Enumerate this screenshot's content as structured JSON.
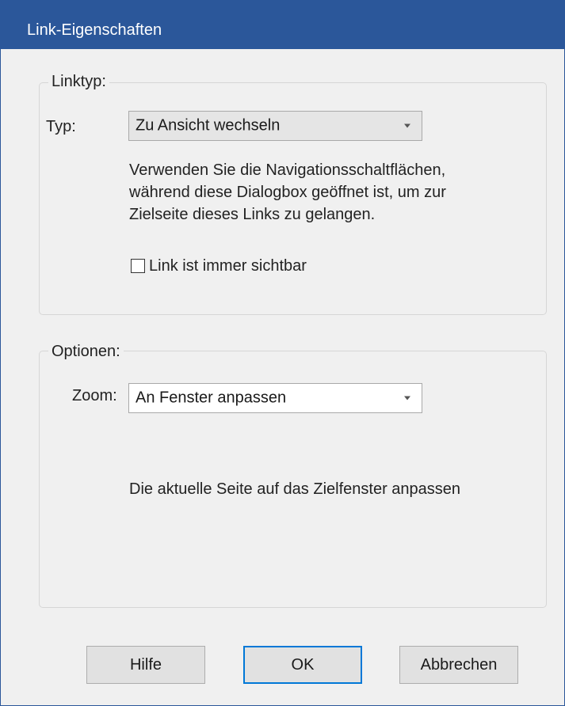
{
  "window": {
    "title": "Link-Eigenschaften",
    "accent_color": "#2b579a"
  },
  "linktype": {
    "legend": "Linktyp:",
    "type_label": "Typ:",
    "type_value": "Zu Ansicht wechseln",
    "description_lines": [
      "Verwenden Sie die Navigationsschaltflächen,",
      "während diese Dialogbox geöffnet ist, um zur",
      "Zielseite dieses Links zu gelangen."
    ],
    "always_visible_label": "Link ist immer sichtbar",
    "always_visible_checked": false
  },
  "options": {
    "legend": "Optionen:",
    "zoom_label": "Zoom:",
    "zoom_value": "An Fenster anpassen",
    "zoom_description": "Die aktuelle Seite auf das Zielfenster anpassen"
  },
  "buttons": {
    "help": "Hilfe",
    "ok": "OK",
    "cancel": "Abbrechen"
  }
}
